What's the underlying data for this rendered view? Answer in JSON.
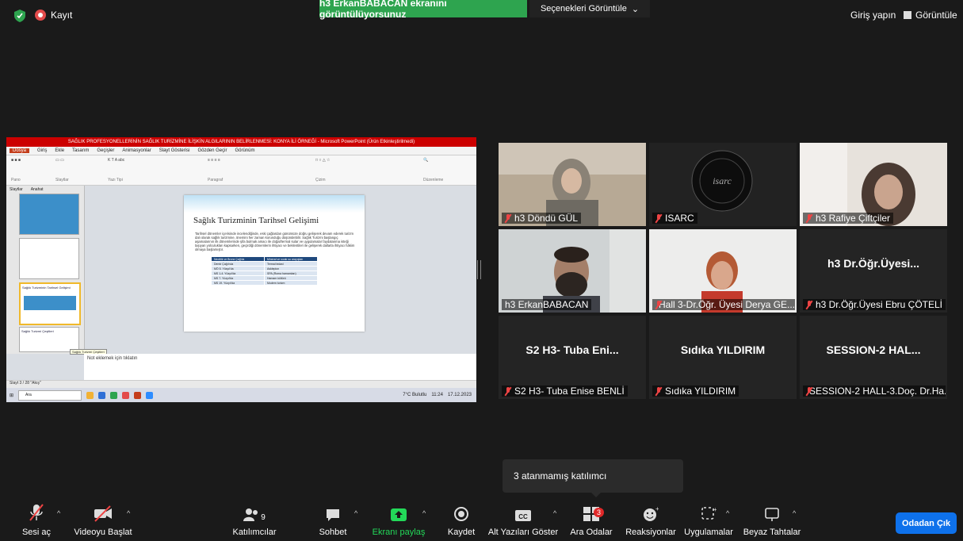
{
  "topbar": {
    "recording_label": "Kayıt",
    "share_banner": "h3 ErkanBABACAN ekranını görüntülüyorsunuz",
    "view_options": "Seçenekleri Görüntüle",
    "login": "Giriş yapın",
    "view": "Görüntüle"
  },
  "shared_screen": {
    "window_title": "SAĞLIK PROFESYONELLERİNİN SAĞLIK TURİZMİNE İLİŞKİN ALGILARININ BELİRLENMESİ: KONYA İLİ ÖRNEĞİ - Microsoft PowerPoint (Ürün Etkinleştirilmedi)",
    "ribbon_tabs": [
      "Dosya",
      "Giriş",
      "Ekle",
      "Tasarım",
      "Geçişler",
      "Animasyonlar",
      "Slayt Gösterisi",
      "Gözden Geçir",
      "Görünüm"
    ],
    "ribbon_groups": [
      "Pano",
      "Slaytlar",
      "Yazı Tipi",
      "Paragraf",
      "Çizim",
      "Düzenleme"
    ],
    "panel_tabs": [
      "Slaytlar",
      "Anahat"
    ],
    "slide_title": "Sağlık Turizminin Tarihsel Gelişimi",
    "slide_text": "Tarihsel dönemler içerisinde incelendiğinde, eski çağlardan günümüze doğru gelişerek devam ederek turizm dalı olarak sağlık turizmine, önemini her zaman korunduğu düşünülebilir. Sağlık Turizmi başlangıç aşamalarının ilk dönemlerinde şifa bulmak amacı ile doğal/termal sular ve uygulamalar faydalanma isteği taşıyan yolculukları kapsarken, geçirdiği dönemlerin ihtiyacı ve beklentileri ile gelişerek dallarla ihtiyacı hâkim olmaya başlamıştır.",
    "slide_table": [
      [
        "Neolitik ve Bronz Çağ'da",
        "Mineral ve sıcak su arayışları"
      ],
      [
        "Demir Çağı'nda",
        "Termal tedavi"
      ],
      [
        "MÖ 5. Yüzyıl'da",
        "Asklepion"
      ],
      [
        "MS 1-4. Yüzyıl'da",
        "SPA (Roma hamamları)"
      ],
      [
        "MS 7. Yüzyıl'da",
        "Hamam kültürü"
      ],
      [
        "MS 19. Yüzyıl'da",
        "Modern turizm"
      ]
    ],
    "notes_placeholder": "Not eklemek için tıklatın",
    "tooltip": "Sağlık Turizmi Çeşitleri",
    "status": "Slayt 3 / 28    \"Akış\"",
    "search": "Ara",
    "weather": "7°C Bulutlu",
    "time": "11:24",
    "date": "17.12.2023"
  },
  "participants": [
    {
      "name": "h3 Döndü GÜL",
      "muted": true
    },
    {
      "name": "ISARC",
      "muted": true
    },
    {
      "name": "h3 Rafiye Çiftçiler",
      "muted": true
    },
    {
      "name": "h3 ErkanBABACAN",
      "muted": false,
      "speaking": true
    },
    {
      "name": "Hall 3-Dr.Öğr. Üyesi Derya GE...",
      "muted": true
    },
    {
      "name": "h3 Dr.Öğr.Üyesi Ebru ÇÖTELİ",
      "muted": true,
      "display": "h3  Dr.Öğr.Üyesi..."
    },
    {
      "name": "S2 H3- Tuba Enise BENLİ",
      "muted": true,
      "display": "S2 H3- Tuba Eni..."
    },
    {
      "name": "Sıdıka YILDIRIM",
      "muted": true,
      "display": "Sıdıka YILDIRIM"
    },
    {
      "name": "SESSION-2 HALL-3.Doç. Dr.Ha...",
      "muted": true,
      "display": "SESSION-2  HAL..."
    }
  ],
  "tooltip": "3 atanmamış katılımcı",
  "toolbar": {
    "unmute": "Sesi aç",
    "start_video": "Videoyu Başlat",
    "participants": "Katılımcılar",
    "participants_count": "9",
    "chat": "Sohbet",
    "share": "Ekranı paylaş",
    "record": "Kaydet",
    "captions": "Alt Yazıları Göster",
    "breakout": "Ara Odalar",
    "breakout_badge": "3",
    "reactions": "Reaksiyonlar",
    "apps": "Uygulamalar",
    "whiteboards": "Beyaz Tahtalar",
    "leave": "Odadan Çık"
  },
  "colors": {
    "share_green": "#2ea44f",
    "leave_blue": "#0e71eb",
    "active_outline": "#e8e46a",
    "mute_red": "#e44444"
  }
}
